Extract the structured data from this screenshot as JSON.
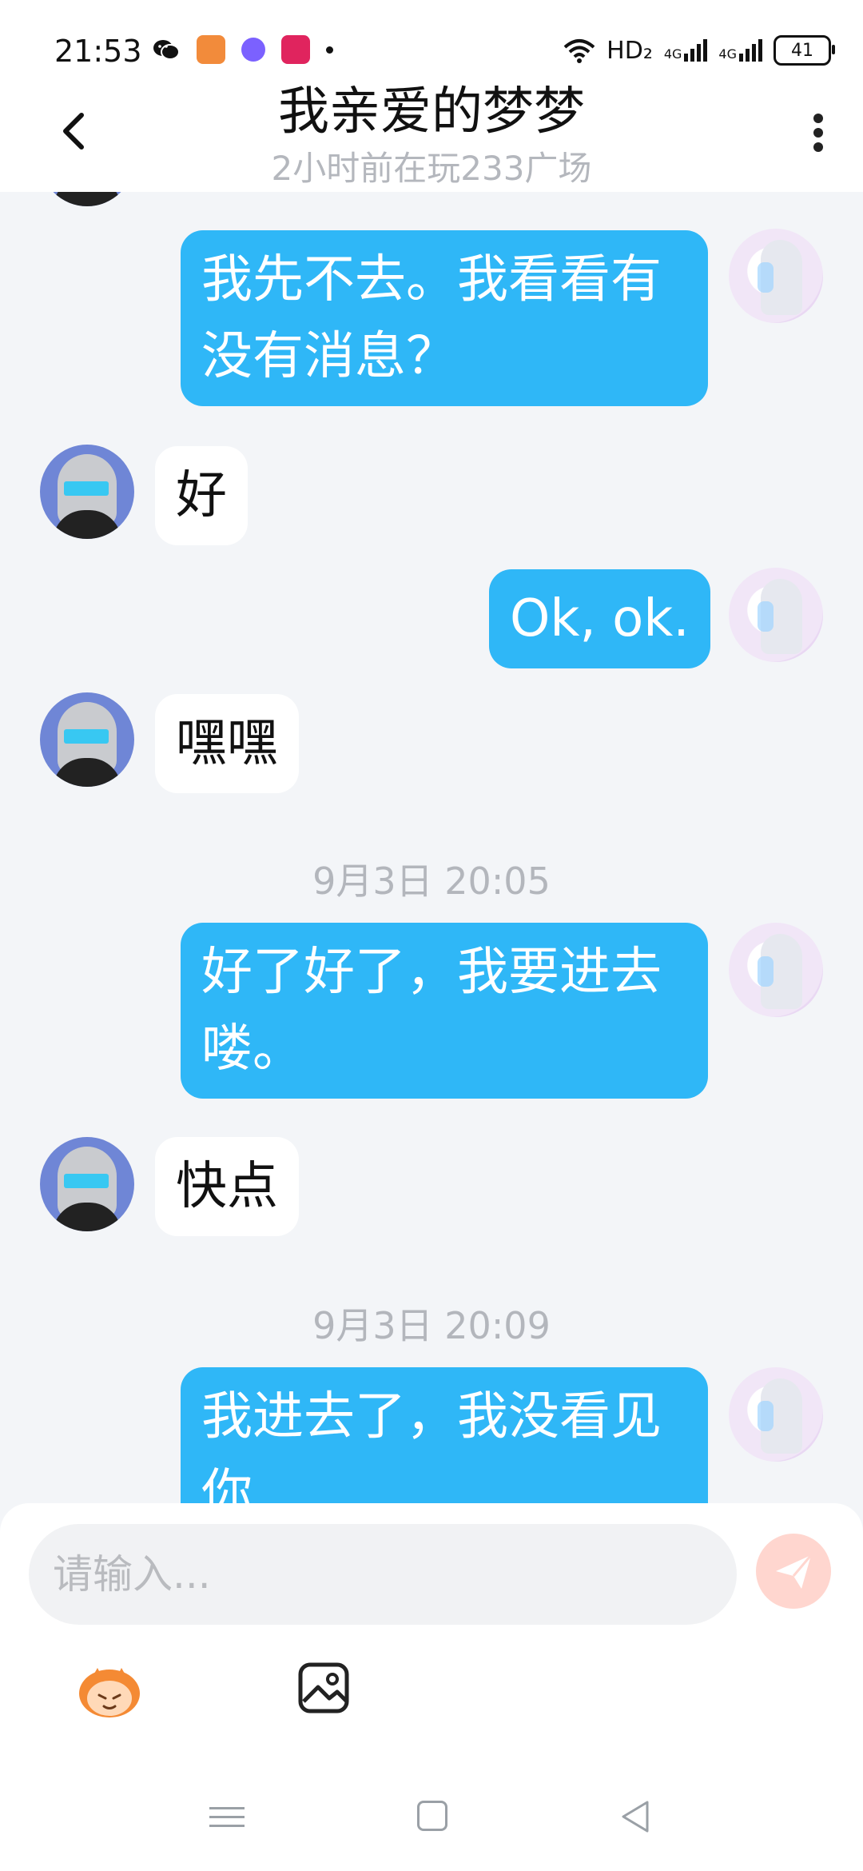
{
  "status_bar": {
    "time": "21:53",
    "network": "HD₂",
    "signal1": "4G",
    "signal2": "4G",
    "battery": "41"
  },
  "header": {
    "title": "我亲爱的梦梦",
    "subtitle": "2小时前在玩233广场"
  },
  "messages": [
    {
      "from": "me",
      "text": "我先不去。我看看有没有消息？"
    },
    {
      "from": "other",
      "text": "好"
    },
    {
      "from": "me",
      "text": "Ok, ok."
    },
    {
      "from": "other",
      "text": "嘿嘿"
    },
    {
      "time": "9月3日 20:05"
    },
    {
      "from": "me",
      "text": "好了好了，我要进去喽。"
    },
    {
      "from": "other",
      "text": "快点"
    },
    {
      "time": "9月3日 20:09"
    },
    {
      "from": "me",
      "text": "我进去了，我没看见你"
    }
  ],
  "input": {
    "placeholder": "请输入..."
  },
  "colors": {
    "my_bubble": "#2fb7f7",
    "other_bubble": "#ffffff",
    "background": "#f3f5f8",
    "send_button": "#ffd6cf"
  },
  "icons": {
    "back": "chevron-left-icon",
    "more": "more-vertical-icon",
    "send": "paper-plane-icon",
    "emoji": "emoji-mascot-icon",
    "image": "image-icon"
  }
}
